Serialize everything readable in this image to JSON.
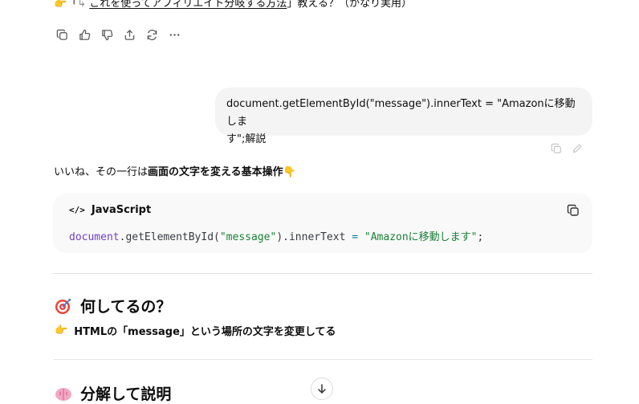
{
  "previous": {
    "hand_emoji": "👉",
    "open_bracket": "「",
    "arrow": "↳",
    "link_text": "これを使ってアフィリエイト分岐する方法",
    "close_bracket": "」",
    "suffix": "教える？（かなり実用）"
  },
  "message_actions": [
    "copy-icon",
    "thumbs-up-icon",
    "thumbs-down-icon",
    "share-icon",
    "regenerate-icon",
    "more-icon"
  ],
  "user_message": {
    "line1": "document.getElementById(\"message\").innerText = \"Amazonに移動しま",
    "line2": "す\";解説"
  },
  "assistant": {
    "intro_prefix": "いいね、その一行は",
    "intro_bold": "画面の文字を変える基本操作",
    "intro_emoji": "👇",
    "code": {
      "lang_icon": "</>",
      "language": "JavaScript",
      "tokens": {
        "obj": "document",
        "method": ".getElementById(",
        "arg": "\"message\"",
        "prop": ").innerText ",
        "op": "=",
        "space": " ",
        "value": "\"Amazonに移動します\"",
        "end": ";"
      }
    },
    "section1": {
      "heading": "何してるの？",
      "point_emoji": "👉",
      "point_text": "HTMLの「message」という場所の文字を変更してる"
    },
    "section2": {
      "heading": "分解して説明"
    }
  },
  "colors": {
    "code_object": "#6f42c1",
    "code_string": "#1a7f37",
    "bubble_bg": "#f4f4f4"
  }
}
